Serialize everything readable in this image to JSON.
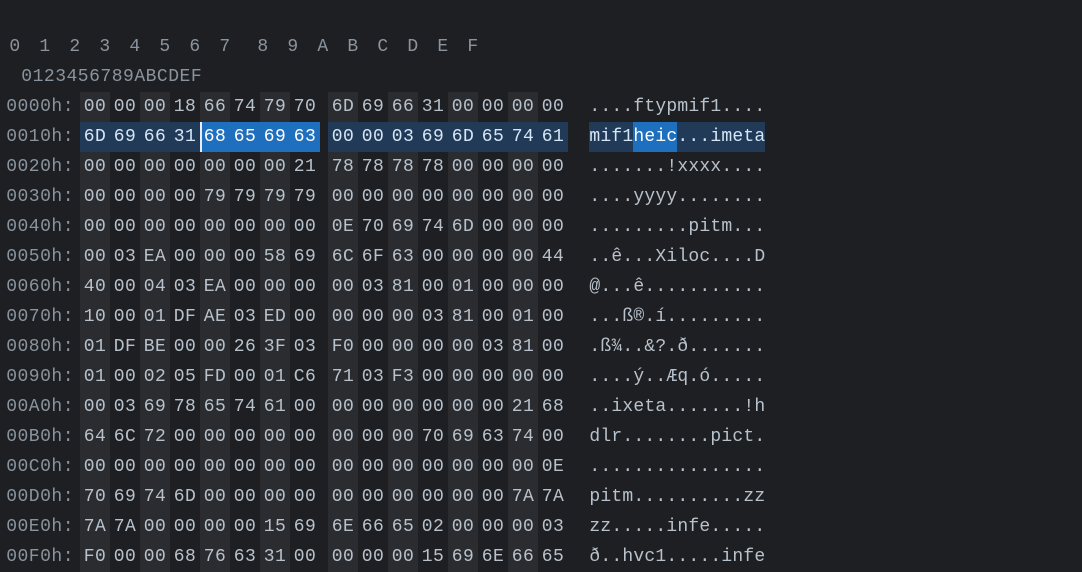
{
  "colors": {
    "bg": "#1e1f22",
    "zebra": "#2a2c30",
    "selDark": "#203a57",
    "selBright": "#1f6fbf",
    "text": "#b8c2cc",
    "dim": "#8a949e"
  },
  "header": {
    "hexCols": [
      "0",
      "1",
      "2",
      "3",
      "4",
      "5",
      "6",
      "7",
      "8",
      "9",
      "A",
      "B",
      "C",
      "D",
      "E",
      "F"
    ],
    "asciiHeader": "0123456789ABCDEF"
  },
  "selection": {
    "row": 1,
    "allCols": [
      0,
      1,
      2,
      3,
      4,
      5,
      6,
      7,
      8,
      9,
      10,
      11,
      12,
      13,
      14,
      15
    ],
    "brightCols": [
      4,
      5,
      6,
      7
    ],
    "caretCol": 4
  },
  "rows": [
    {
      "addr": "0000h:",
      "hex": [
        "00",
        "00",
        "00",
        "18",
        "66",
        "74",
        "79",
        "70",
        "6D",
        "69",
        "66",
        "31",
        "00",
        "00",
        "00",
        "00"
      ],
      "ascii": "....ftypmif1...."
    },
    {
      "addr": "0010h:",
      "hex": [
        "6D",
        "69",
        "66",
        "31",
        "68",
        "65",
        "69",
        "63",
        "00",
        "00",
        "03",
        "69",
        "6D",
        "65",
        "74",
        "61"
      ],
      "ascii": "mif1heic...imeta"
    },
    {
      "addr": "0020h:",
      "hex": [
        "00",
        "00",
        "00",
        "00",
        "00",
        "00",
        "00",
        "21",
        "78",
        "78",
        "78",
        "78",
        "00",
        "00",
        "00",
        "00"
      ],
      "ascii": ".......!xxxx...."
    },
    {
      "addr": "0030h:",
      "hex": [
        "00",
        "00",
        "00",
        "00",
        "79",
        "79",
        "79",
        "79",
        "00",
        "00",
        "00",
        "00",
        "00",
        "00",
        "00",
        "00"
      ],
      "ascii": "....yyyy........"
    },
    {
      "addr": "0040h:",
      "hex": [
        "00",
        "00",
        "00",
        "00",
        "00",
        "00",
        "00",
        "00",
        "0E",
        "70",
        "69",
        "74",
        "6D",
        "00",
        "00",
        "00"
      ],
      "ascii": ".........pitm..."
    },
    {
      "addr": "0050h:",
      "hex": [
        "00",
        "03",
        "EA",
        "00",
        "00",
        "00",
        "58",
        "69",
        "6C",
        "6F",
        "63",
        "00",
        "00",
        "00",
        "00",
        "44"
      ],
      "ascii": "..ê...Xiloc....D"
    },
    {
      "addr": "0060h:",
      "hex": [
        "40",
        "00",
        "04",
        "03",
        "EA",
        "00",
        "00",
        "00",
        "00",
        "03",
        "81",
        "00",
        "01",
        "00",
        "00",
        "00"
      ],
      "ascii": "@...ê..........."
    },
    {
      "addr": "0070h:",
      "hex": [
        "10",
        "00",
        "01",
        "DF",
        "AE",
        "03",
        "ED",
        "00",
        "00",
        "00",
        "00",
        "03",
        "81",
        "00",
        "01",
        "00"
      ],
      "ascii": "...ß®.í........."
    },
    {
      "addr": "0080h:",
      "hex": [
        "01",
        "DF",
        "BE",
        "00",
        "00",
        "26",
        "3F",
        "03",
        "F0",
        "00",
        "00",
        "00",
        "00",
        "03",
        "81",
        "00"
      ],
      "ascii": ".ß¾..&?.ð......."
    },
    {
      "addr": "0090h:",
      "hex": [
        "01",
        "00",
        "02",
        "05",
        "FD",
        "00",
        "01",
        "C6",
        "71",
        "03",
        "F3",
        "00",
        "00",
        "00",
        "00",
        "00"
      ],
      "ascii": "....ý..Æq.ó....."
    },
    {
      "addr": "00A0h:",
      "hex": [
        "00",
        "03",
        "69",
        "78",
        "65",
        "74",
        "61",
        "00",
        "00",
        "00",
        "00",
        "00",
        "00",
        "00",
        "21",
        "68"
      ],
      "ascii": "..ixeta.......!h"
    },
    {
      "addr": "00B0h:",
      "hex": [
        "64",
        "6C",
        "72",
        "00",
        "00",
        "00",
        "00",
        "00",
        "00",
        "00",
        "00",
        "70",
        "69",
        "63",
        "74",
        "00"
      ],
      "ascii": "dlr........pict."
    },
    {
      "addr": "00C0h:",
      "hex": [
        "00",
        "00",
        "00",
        "00",
        "00",
        "00",
        "00",
        "00",
        "00",
        "00",
        "00",
        "00",
        "00",
        "00",
        "00",
        "0E"
      ],
      "ascii": "................"
    },
    {
      "addr": "00D0h:",
      "hex": [
        "70",
        "69",
        "74",
        "6D",
        "00",
        "00",
        "00",
        "00",
        "00",
        "00",
        "00",
        "00",
        "00",
        "00",
        "7A",
        "7A"
      ],
      "ascii": "pitm..........zz"
    },
    {
      "addr": "00E0h:",
      "hex": [
        "7A",
        "7A",
        "00",
        "00",
        "00",
        "00",
        "15",
        "69",
        "6E",
        "66",
        "65",
        "02",
        "00",
        "00",
        "00",
        "03"
      ],
      "ascii": "zz.....infe....."
    },
    {
      "addr": "00F0h:",
      "hex": [
        "F0",
        "00",
        "00",
        "68",
        "76",
        "63",
        "31",
        "00",
        "00",
        "00",
        "00",
        "15",
        "69",
        "6E",
        "66",
        "65"
      ],
      "ascii": "ð..hvc1.....infe"
    }
  ],
  "chart_data": null
}
